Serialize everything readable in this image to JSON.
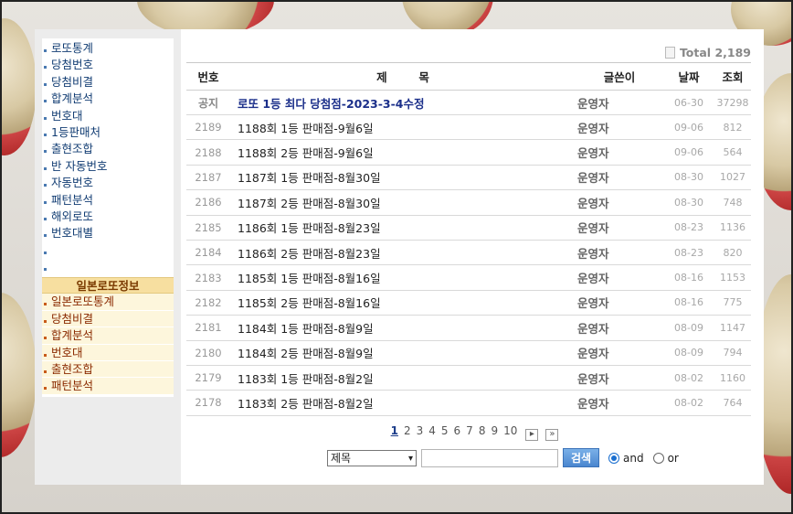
{
  "sidebar": {
    "menu": [
      "로또통계",
      "당첨번호",
      "당첨비결",
      "합계분석",
      "번호대",
      "1등판매처",
      "출현조합",
      "반 자동번호",
      "자동번호",
      "패턴분석",
      "해외로또",
      "번호대별",
      "",
      ""
    ],
    "jp_header": "일본로또정보",
    "jp_menu": [
      "일본로또통계",
      "당첨비결",
      "합계분석",
      "번호대",
      "출현조합",
      "패턴분석"
    ]
  },
  "board": {
    "total_label": "Total",
    "total_count": "2,189",
    "headers": {
      "num": "번호",
      "title": "제        목",
      "writer": "글쓴이",
      "date": "날짜",
      "views": "조회"
    },
    "notice": {
      "num": "공지",
      "title": "로또 1등 최다 당첨점-2023-3-4수정",
      "writer": "운영자",
      "date": "06-30",
      "views": "37298"
    },
    "rows": [
      {
        "num": "2189",
        "title": "1188회 1등 판매점-9월6일",
        "writer": "운영자",
        "date": "09-06",
        "views": "812"
      },
      {
        "num": "2188",
        "title": "1188회 2등 판매점-9월6일",
        "writer": "운영자",
        "date": "09-06",
        "views": "564"
      },
      {
        "num": "2187",
        "title": "1187회 1등 판매점-8월30일",
        "writer": "운영자",
        "date": "08-30",
        "views": "1027"
      },
      {
        "num": "2186",
        "title": "1187회 2등 판매점-8월30일",
        "writer": "운영자",
        "date": "08-30",
        "views": "748"
      },
      {
        "num": "2185",
        "title": "1186회 1등 판매점-8월23일",
        "writer": "운영자",
        "date": "08-23",
        "views": "1136"
      },
      {
        "num": "2184",
        "title": "1186회 2등 판매점-8월23일",
        "writer": "운영자",
        "date": "08-23",
        "views": "820"
      },
      {
        "num": "2183",
        "title": "1185회 1등 판매점-8월16일",
        "writer": "운영자",
        "date": "08-16",
        "views": "1153"
      },
      {
        "num": "2182",
        "title": "1185회 2등 판매점-8월16일",
        "writer": "운영자",
        "date": "08-16",
        "views": "775"
      },
      {
        "num": "2181",
        "title": "1184회 1등 판매점-8월9일",
        "writer": "운영자",
        "date": "08-09",
        "views": "1147"
      },
      {
        "num": "2180",
        "title": "1184회 2등 판매점-8월9일",
        "writer": "운영자",
        "date": "08-09",
        "views": "794"
      },
      {
        "num": "2179",
        "title": "1183회 1등 판매점-8월2일",
        "writer": "운영자",
        "date": "08-02",
        "views": "1160"
      },
      {
        "num": "2178",
        "title": "1183회 2등 판매점-8월2일",
        "writer": "운영자",
        "date": "08-02",
        "views": "764"
      }
    ]
  },
  "pager": {
    "pages": [
      "1",
      "2",
      "3",
      "4",
      "5",
      "6",
      "7",
      "8",
      "9",
      "10"
    ],
    "current": "1",
    "next_icon": "next-page-icon",
    "last_icon": "last-page-icon"
  },
  "search": {
    "field_selected": "제목",
    "query": "",
    "button_label": "검색",
    "radio_and": "and",
    "radio_or": "or",
    "selected_mode": "and"
  },
  "colors": {
    "accent": "#1b2f8a",
    "jp_header_bg": "#f7dfa0",
    "search_button": "#4a86cf"
  }
}
